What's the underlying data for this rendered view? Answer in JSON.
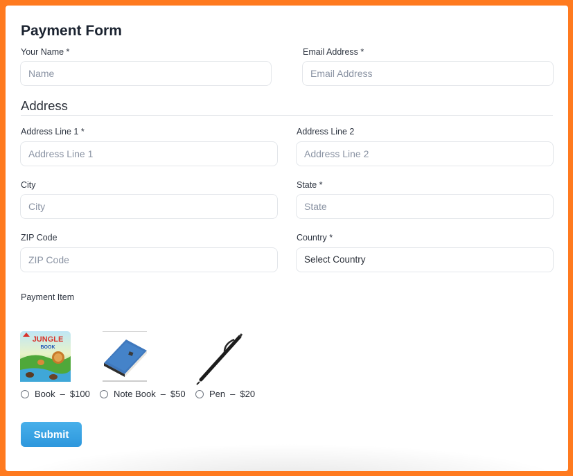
{
  "form": {
    "title": "Payment Form",
    "name": {
      "label": "Your Name *",
      "placeholder": "Name",
      "value": ""
    },
    "email": {
      "label": "Email Address *",
      "placeholder": "Email Address",
      "value": ""
    }
  },
  "address": {
    "section_title": "Address",
    "line1": {
      "label": "Address Line 1 *",
      "placeholder": "Address Line 1",
      "value": ""
    },
    "line2": {
      "label": "Address Line 2",
      "placeholder": "Address Line 2",
      "value": ""
    },
    "city": {
      "label": "City",
      "placeholder": "City",
      "value": ""
    },
    "state": {
      "label": "State *",
      "placeholder": "State",
      "value": ""
    },
    "zip": {
      "label": "ZIP Code",
      "placeholder": "ZIP Code",
      "value": ""
    },
    "country": {
      "label": "Country *",
      "selected": "Select Country"
    }
  },
  "payment": {
    "label": "Payment Item",
    "items": [
      {
        "name": "Book",
        "sep": "–",
        "price": "$100",
        "image": "jungle-book-image",
        "selected": false
      },
      {
        "name": "Note Book",
        "sep": "–",
        "price": "$50",
        "image": "notebook-image",
        "selected": false
      },
      {
        "name": "Pen",
        "sep": "–",
        "price": "$20",
        "image": "pen-image",
        "selected": false
      }
    ]
  },
  "submit_label": "Submit",
  "colors": {
    "frame": "#ff7a1f",
    "accent": "#2d97dd",
    "title": "#1b2330"
  }
}
